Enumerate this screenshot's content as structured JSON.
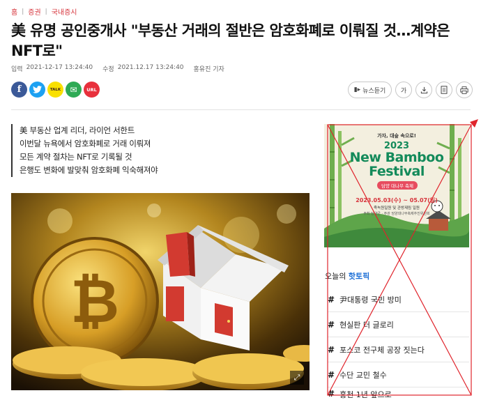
{
  "breadcrumb": [
    "홈",
    "증권",
    "국내증시"
  ],
  "headline": "美 유명 공인중개사 \"부동산 거래의 절반은 암호화폐로 이뤄질 것…계약은 NFT로\"",
  "meta": {
    "input_label": "입력",
    "input_time": "2021-12-17 13:24:40",
    "modified_label": "수정",
    "modified_time": "2021.12.17 13:24:40",
    "author": "홍유진 기자"
  },
  "share": [
    {
      "icon": "facebook-icon",
      "glyph": "f",
      "color": "#3b5998"
    },
    {
      "icon": "twitter-icon",
      "glyph": "t",
      "color": "#1da1f2"
    },
    {
      "icon": "kakaotalk-icon",
      "glyph": "TALK",
      "color": "#f9e000"
    },
    {
      "icon": "email-icon",
      "glyph": "✉",
      "color": "#2eaa55"
    },
    {
      "icon": "url-icon",
      "glyph": "URL",
      "color": "#e8303c"
    }
  ],
  "tools": {
    "news_listen": "뉴스듣기",
    "font_size": "가"
  },
  "summary": [
    "美 부동산 업계 리더, 라이언 서한트",
    "이번달 뉴욕에서 암호화폐로 거래 이뤄져",
    "모든 계약 절차는 NFT로 기록될 것",
    "은행도 변화에 발맞춰 암호화폐 익숙해져야"
  ],
  "ad": {
    "tagline": "가자, 대숲 속으로!",
    "year": "2023",
    "title_line1": "New Bamboo",
    "title_line2": "Festival",
    "badge": "담양 대나무 축제",
    "dates": "2023.05.03(수) ~ 05.07(일)",
    "venue": "죽녹원일원 및 관방제림 일원",
    "organizer": "주최 담양군 · 주관 담양대나무축제추진위원회"
  },
  "hot_topic": {
    "prefix": "오늘의",
    "accent": "핫토픽",
    "items": [
      "尹대통령 국빈 방미",
      "현실판 더 글로리",
      "포스코 전구체 공장 짓는다",
      "수단 교민 철수",
      "홍천 1년 앞으로"
    ]
  },
  "colors": {
    "brand_red": "#d6323a",
    "accent_blue": "#1b6ed6",
    "cross_red": "#e0242c"
  }
}
